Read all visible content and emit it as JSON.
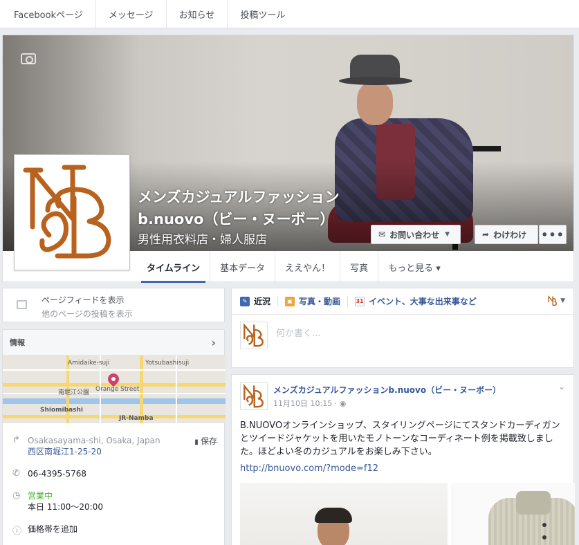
{
  "topnav": {
    "items": [
      "Facebookページ",
      "メッセージ",
      "お知らせ",
      "投稿ツール"
    ]
  },
  "page": {
    "name_line1": "メンズカジュアルファッション",
    "name_line2": "b.nuovo（ビー・ヌーボー）",
    "category": "男性用衣料店・婦人服店",
    "contact_button": "お問い合わせ",
    "share_button": "わけわけ",
    "more_button": "•••"
  },
  "tabs": [
    "タイムライン",
    "基本データ",
    "ええやん！",
    "写真",
    "もっと見る ▾"
  ],
  "feed_card": {
    "line1": "ページフィードを表示",
    "line2": "他のページの投稿を表示"
  },
  "info": {
    "title": "情報",
    "map_labels": {
      "street1": "Amidaike-suji",
      "street2": "Yotsubashisuji",
      "park": "南堀江公園",
      "orange": "Orange Street",
      "station1": "Shiomibashi",
      "station2": "JR-Namba"
    },
    "address_line1": "Osakasayama-shi, Osaka, Japan",
    "address_line2": "西区南堀江1-25-20",
    "save_label": "保存",
    "phone": "06-4395-5768",
    "open_status": "営業中",
    "hours": "本日 11:00〜20:00",
    "price_prompt": "価格帯を追加"
  },
  "composer": {
    "tab_status": "近況",
    "tab_photo": "写真・動画",
    "tab_event": "イベント、大事な出来事など",
    "calendar_day": "31",
    "placeholder": "何か書く..."
  },
  "post": {
    "author": "メンズカジュアルファッションb.nuovo（ビー・ヌーボー）",
    "date": "11月10日 10:15 · ",
    "text": "B.NUOVOオンラインショップ、スタイリングページにてスタンドカーディガンとツイードジャケットを用いたモノトーンなコーディネート例を掲載致しました。ほどよい冬のカジュアルをお楽しみ下さい。",
    "link": "http://bnuovo.com/?mode=f12"
  },
  "colors": {
    "brand": "#4267b2",
    "logo": "#b8621e",
    "link": "#365899"
  }
}
